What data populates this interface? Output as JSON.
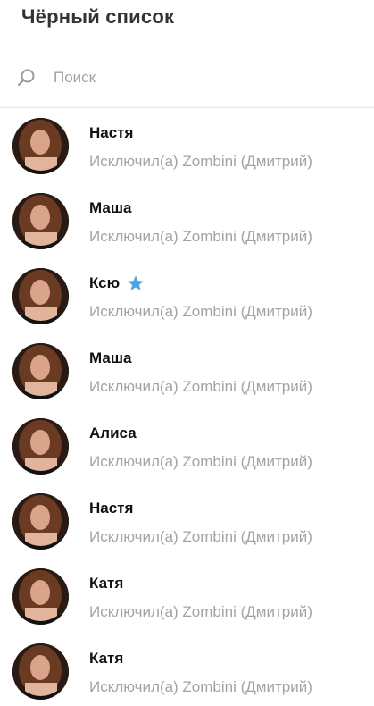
{
  "header": {
    "title": "Чёрный список"
  },
  "search": {
    "placeholder": "Поиск",
    "icon": "search-icon"
  },
  "colors": {
    "accent_star": "#4ea3e0",
    "muted_text": "#a3a3a3",
    "name_text": "#111111"
  },
  "contacts": [
    {
      "name": "Настя",
      "status": "Исключил(а) Zombini (Дмитрий)",
      "verified": false
    },
    {
      "name": "Маша",
      "status": "Исключил(а) Zombini (Дмитрий)",
      "verified": false
    },
    {
      "name": "Ксю",
      "status": "Исключил(а) Zombini (Дмитрий)",
      "verified": true
    },
    {
      "name": "Маша",
      "status": "Исключил(а) Zombini (Дмитрий)",
      "verified": false
    },
    {
      "name": "Алиса",
      "status": "Исключил(а) Zombini (Дмитрий)",
      "verified": false
    },
    {
      "name": "Настя",
      "status": "Исключил(а) Zombini (Дмитрий)",
      "verified": false
    },
    {
      "name": "Катя",
      "status": "Исключил(а) Zombini (Дмитрий)",
      "verified": false
    },
    {
      "name": "Катя",
      "status": "Исключил(а) Zombini (Дмитрий)",
      "verified": false
    }
  ]
}
